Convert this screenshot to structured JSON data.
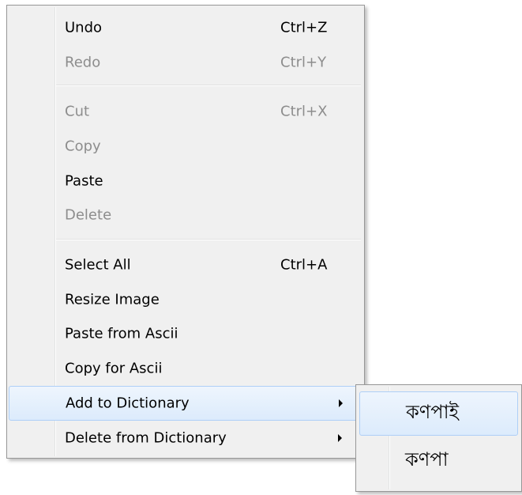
{
  "context_menu": {
    "items": [
      {
        "label": "Undo",
        "shortcut": "Ctrl+Z",
        "enabled": true
      },
      {
        "label": "Redo",
        "shortcut": "Ctrl+Y",
        "enabled": false
      },
      {
        "label": "Cut",
        "shortcut": "Ctrl+X",
        "enabled": false
      },
      {
        "label": "Copy",
        "shortcut": "",
        "enabled": false
      },
      {
        "label": "Paste",
        "shortcut": "",
        "enabled": true
      },
      {
        "label": "Delete",
        "shortcut": "",
        "enabled": false
      },
      {
        "label": "Select All",
        "shortcut": "Ctrl+A",
        "enabled": true
      },
      {
        "label": "Resize Image",
        "shortcut": "",
        "enabled": true
      },
      {
        "label": "Paste from Ascii",
        "shortcut": "",
        "enabled": true
      },
      {
        "label": "Copy for Ascii",
        "shortcut": "",
        "enabled": true
      },
      {
        "label": "Add to Dictionary",
        "shortcut": "",
        "enabled": true,
        "highlighted": true,
        "submenu_icon": "chevron-right-icon"
      },
      {
        "label": "Delete from Dictionary",
        "shortcut": "",
        "enabled": true,
        "submenu_icon": "chevron-right-icon"
      }
    ]
  },
  "submenu": {
    "items": [
      {
        "label": "কণপাই",
        "highlighted": true
      },
      {
        "label": "কণপা",
        "highlighted": false
      }
    ]
  },
  "colors": {
    "menu_background": "#f0f0f0",
    "menu_border": "#979797",
    "disabled_text": "#8d8d8d",
    "highlight_border": "#aecff7",
    "highlight_fill": "#dcebfc"
  }
}
